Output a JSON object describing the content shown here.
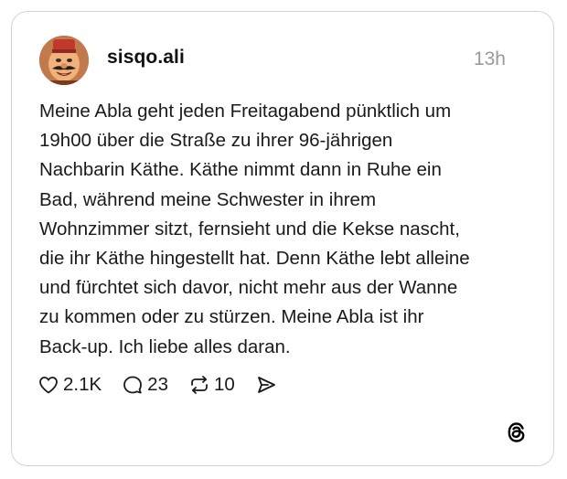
{
  "post": {
    "username": "sisqo.ali",
    "timestamp": "13h",
    "text": "Meine Abla geht jeden Freitagabend pünktlich um\n19h00 über die Straße zu ihrer 96-jährigen\nNachbarin Käthe. Käthe nimmt dann in Ruhe ein\nBad, während meine Schwester in ihrem\nWohnzimmer sitzt, fernsieht und die Kekse nascht,\ndie ihr Käthe hingestellt hat. Denn Käthe lebt alleine\nund fürchtet sich davor, nicht mehr aus der Wanne\nzu kommen oder zu stürzen. Meine Abla ist ihr\nBack-up. Ich liebe alles daran."
  },
  "actions": {
    "likes": "2.1K",
    "replies": "23",
    "reposts": "10"
  },
  "icons": {
    "avatar": "avatar-man-with-fez",
    "like": "heart-outline-icon",
    "reply": "speech-bubble-icon",
    "repost": "repost-arrows-icon",
    "share": "send-paper-plane-icon",
    "brand": "threads-logo-icon"
  },
  "colors": {
    "text": "#1a1a1a",
    "timestamp": "#9a9a9a",
    "border": "#d4d4d4"
  }
}
